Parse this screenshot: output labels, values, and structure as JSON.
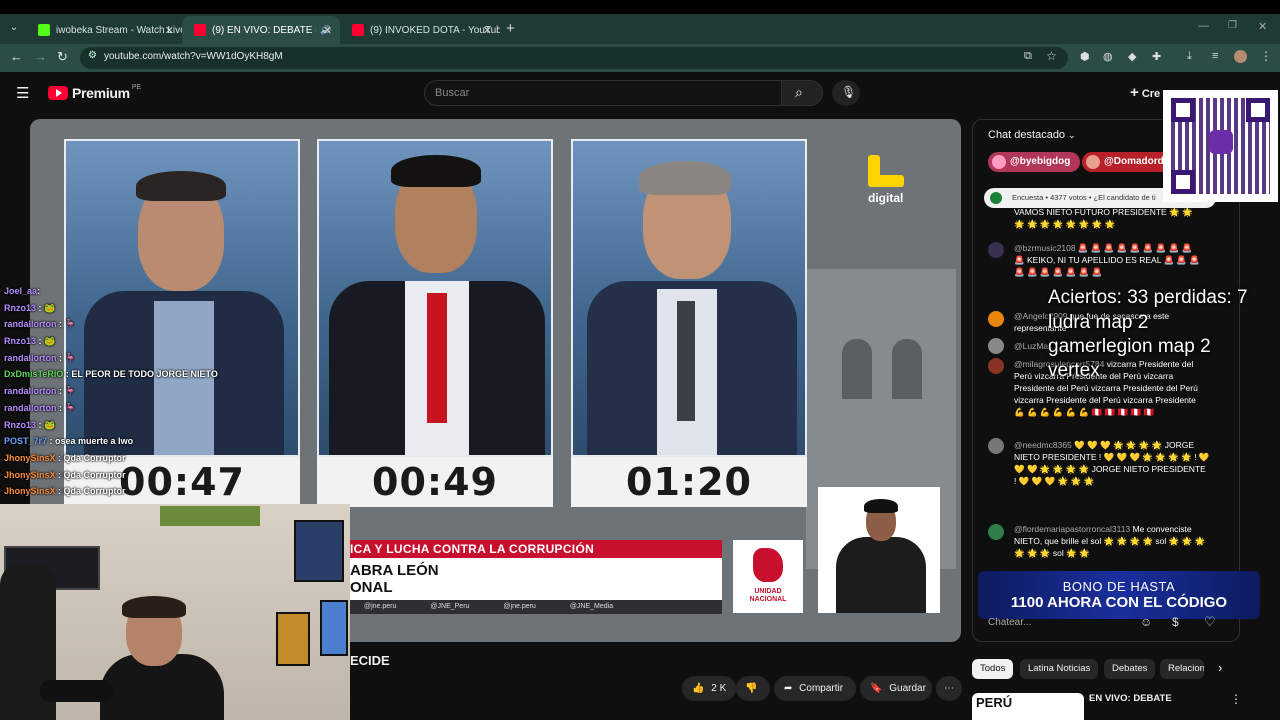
{
  "browser": {
    "tabs": [
      {
        "title": "iwobeka Stream - Watch Live o",
        "active": false,
        "favicon_color": "#53fc18"
      },
      {
        "title": "(9) EN VIVO: DEBATE PRESI",
        "active": true,
        "favicon_color": "#ff0033"
      },
      {
        "title": "(9) INVOKED DOTA - YouTube",
        "active": false,
        "favicon_color": "#ff0033"
      }
    ],
    "url": "youtube.com/watch?v=WW1dOyKH8gM"
  },
  "youtube": {
    "logo_text": "Premium",
    "logo_region": "PE",
    "search_placeholder": "Buscar",
    "create_label": "Cre"
  },
  "video": {
    "timers": [
      "00:47",
      "00:49",
      "01:20"
    ],
    "channel_logo_text": "digital",
    "banner_red": "ICA Y LUCHA CONTRA LA CORRUPCIÓN",
    "banner_name_line1": "ABRA LEÓN",
    "banner_name_line2": "ONAL",
    "socials": [
      "@jne.peru",
      "@JNE_Peru",
      "@jne.peru",
      "@JNE_Media"
    ],
    "party_logo_text": "UNIDAD NACIONAL"
  },
  "overlay_chat": [
    {
      "user": "Joel_aa",
      "text": ""
    },
    {
      "user": "Rnzo13",
      "text": ""
    },
    {
      "user": "randallorton",
      "text": ""
    },
    {
      "user": "Rnzo13",
      "text": ""
    },
    {
      "user": "randallorton",
      "text": ""
    },
    {
      "user": "DxDmisTeRiO",
      "text": "EL PEOR DE TODO JORGE NIETO"
    },
    {
      "user": "randallorton",
      "text": ""
    },
    {
      "user": "randallorton",
      "text": ""
    },
    {
      "user": "Rnzo13",
      "text": ""
    },
    {
      "user": "POST_7r7",
      "text": "osea muerte a Iwo"
    },
    {
      "user": "JhonySinsX",
      "text": "Qda Corruptor"
    },
    {
      "user": "JhonySinsX",
      "text": "Qda Corruptor"
    },
    {
      "user": "JhonySinsX",
      "text": "Qda Corruptor"
    }
  ],
  "below_video": {
    "title_stub": "ECIDE",
    "likes": "2 K",
    "share_label": "Compartir",
    "save_label": "Guardar"
  },
  "chat": {
    "header": "Chat destacado",
    "chips": [
      "@byebigdog",
      "@Domadorde"
    ],
    "poll": "Encuesta • 4377 votos • ¿El candidato de ti",
    "messages": [
      {
        "user": "",
        "text": "VAMOS NIETO FUTURO PRESIDENTE 🌟 🌟 🌟 🌟 🌟 🌟 🌟 🌟 🌟 🌟"
      },
      {
        "user": "@bzrmusic2108",
        "text": "🚨 🚨 🚨 🚨 🚨 🚨 🚨 🚨 🚨 🚨 KEIKO, NI TU APELLIDO ES REAL 🚨 🚨 🚨 🚨 🚨 🚨 🚨 🚨 🚨 🚨"
      },
      {
        "user": "@Angelc2909",
        "text": "que fue de sacasco a este representante"
      },
      {
        "user": "@LuzMa",
        "text": ""
      },
      {
        "user": "@milagrosulepcorr5784",
        "text": "vizcarra Presidente del Perú vizcarra Presidente del Perú vizcarra Presidente del Perú vizcarra Presidente del Perú vizcarra Presidente del Perú vizcarra Presidente 💪 💪 💪 💪 💪 💪 🇵🇪 🇵🇪 🇵🇪 🇵🇪 🇵🇪"
      },
      {
        "user": "@needmc8365",
        "text": "💛 💛 💛 🌟 🌟 🌟 🌟 JORGE NIETO PRESIDENTE ! 💛 💛 💛 🌟 🌟 🌟 🌟 ! 💛 💛 💛 🌟 🌟 🌟 🌟 JORGE NIETO PRESIDENTE ! 💛 💛 💛 🌟 🌟 🌟"
      },
      {
        "user": "@flordemariapastorroncal3113",
        "text": "Me convenciste NIETO, que brille el sol 🌟 🌟 🌟 🌟 sol 🌟 🌟 🌟 🌟 🌟 🌟 sol 🌟 🌟"
      }
    ],
    "input_placeholder": "Chatear..."
  },
  "stream_overlay": {
    "stats_line1": "Aciertos: 33 perdidas: 7",
    "stats_line2": "ludra map 2",
    "stats_line3": "gamerlegion map 2",
    "stats_line4": "vertex",
    "promo_line1": "BONO DE HASTA",
    "promo_line2": "1100 AHORA CON EL CÓDIGO"
  },
  "filters": [
    "Todos",
    "Latina Noticias",
    "Debates",
    "Relacion"
  ],
  "related": {
    "title": "EN VIVO: DEBATE",
    "thumb_text": "PERÚ"
  }
}
